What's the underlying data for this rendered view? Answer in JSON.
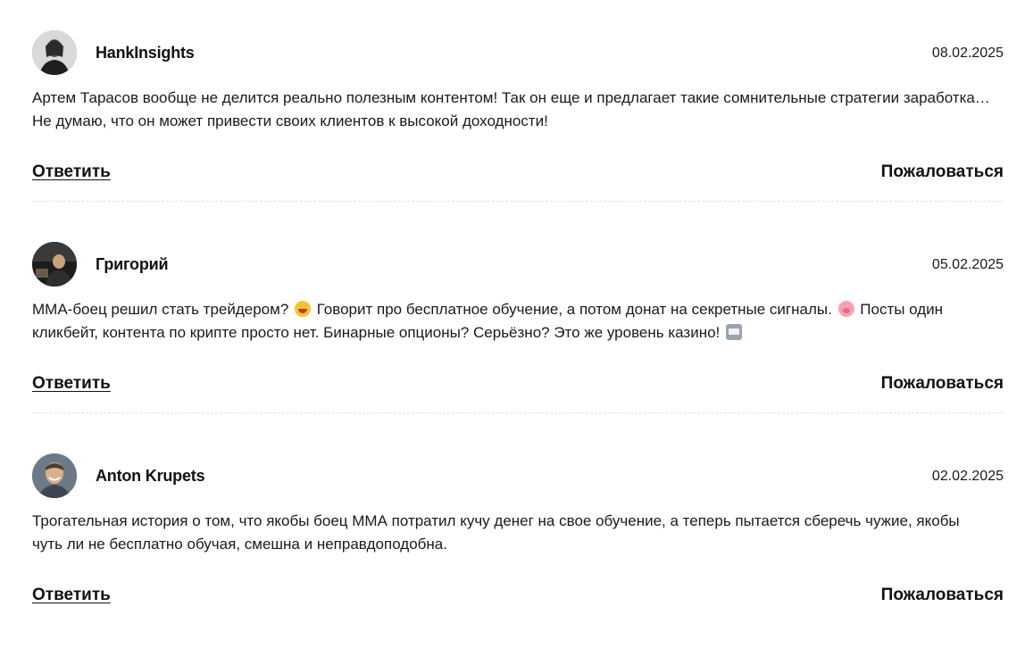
{
  "comments": [
    {
      "author": "HankInsights",
      "date": "08.02.2025",
      "avatar": "avatar-man-long-hair",
      "text_parts": [
        "Артем Тарасов вообще не делится реально полезным контентом! Так он еще и предлагает такие сомнительные стратегии заработка… Не думаю, что он может привести своих клиентов к высокой доходности!"
      ],
      "reply_label": "Ответить",
      "report_label": "Пожаловаться"
    },
    {
      "author": "Григорий",
      "date": "05.02.2025",
      "avatar": "avatar-man-dark",
      "text_parts": [
        "ММА-боец решил стать трейдером? ",
        " Говорит про бесплатное обучение, а потом донат на секретные сигналы. ",
        " Посты один кликбейт, контента по крипте просто нет. Бинарные опционы? Серьёзно? Это же уровень казино! "
      ],
      "emojis": [
        "laughing-face-icon",
        "pig-face-icon",
        "slot-machine-icon"
      ],
      "reply_label": "Ответить",
      "report_label": "Пожаловаться"
    },
    {
      "author": "Anton Krupets",
      "date": "02.02.2025",
      "avatar": "avatar-man-smiling",
      "text_parts": [
        "Трогательная история о том, что якобы боец ММА потратил кучу денег на свое обучение, а теперь пытается сберечь чужие, якобы чуть ли не бесплатно обучая, смешна и неправдоподобна."
      ],
      "reply_label": "Ответить",
      "report_label": "Пожаловаться"
    }
  ]
}
